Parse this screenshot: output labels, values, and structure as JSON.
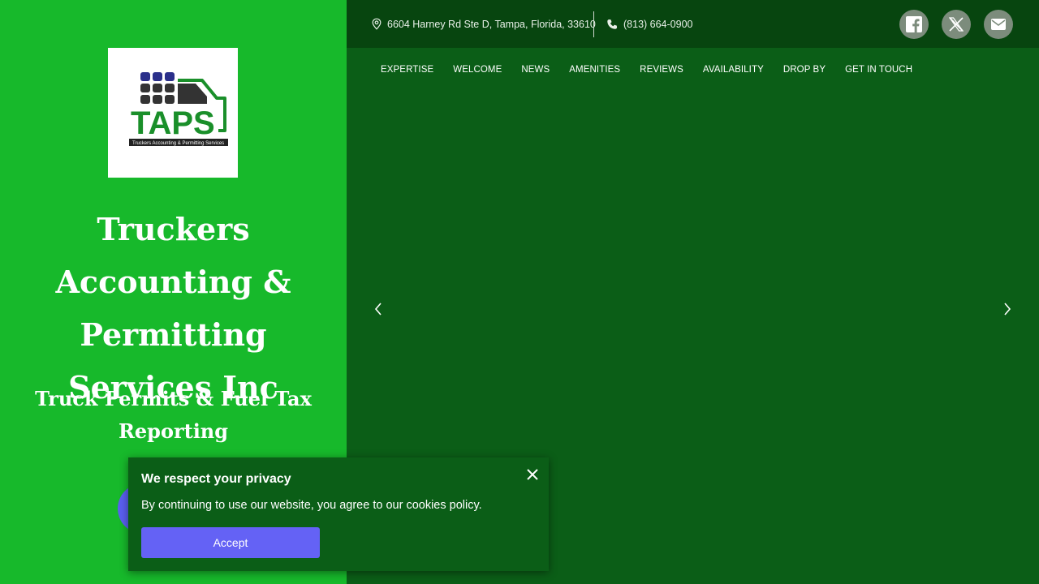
{
  "business": {
    "name": "Truckers Accounting & Permitting Services Inc",
    "tagline": "Truck Permits & Fuel Tax Reporting",
    "logo_text": "TAPS",
    "logo_subtext": "Truckers Accounting & Permitting Services"
  },
  "contact": {
    "address": "6604 Harney Rd Ste D, Tampa, Florida, 33610",
    "phone": "(813) 664-0900"
  },
  "social": [
    "facebook-icon",
    "x-icon",
    "email-icon"
  ],
  "nav": {
    "items": [
      "EXPERTISE",
      "WELCOME",
      "NEWS",
      "AMENITIES",
      "REVIEWS",
      "AVAILABILITY",
      "DROP BY",
      "GET IN TOUCH"
    ]
  },
  "cookie_banner": {
    "title": "We respect your privacy",
    "message": "By continuing to use our website, you agree to our cookies policy.",
    "accept_label": "Accept"
  },
  "colors": {
    "left_panel": "#17b92b",
    "main_bg": "#0b5e17",
    "topbar": "#07450f",
    "accent": "#6462f5"
  }
}
